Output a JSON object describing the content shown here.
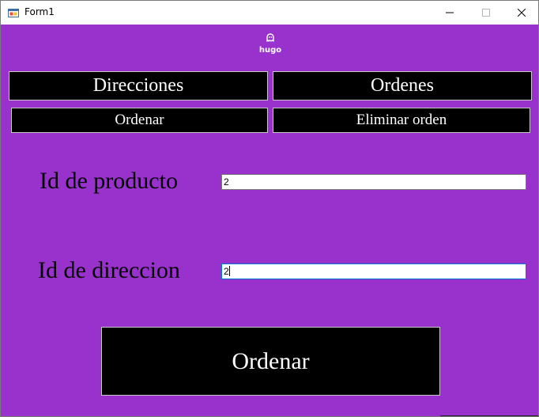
{
  "window": {
    "title": "Form1"
  },
  "logo": {
    "text": "hugo"
  },
  "nav": {
    "direcciones_label": "Direcciones",
    "ordenes_label": "Ordenes",
    "ordenar_label": "Ordenar",
    "eliminar_label": "Eliminar orden"
  },
  "form": {
    "producto_label": "Id de producto",
    "producto_value": "2",
    "direccion_label": "Id de direccion",
    "direccion_value": "2"
  },
  "actions": {
    "submit_label": "Ordenar"
  },
  "colors": {
    "background": "#9932cc",
    "button_bg": "#000000",
    "button_text": "#ffffff",
    "focus_border": "#0078d7"
  },
  "icons": {
    "app": "form-app-icon",
    "logo": "ghost-icon",
    "minimize": "minimize-icon",
    "maximize": "maximize-icon",
    "close": "close-icon"
  }
}
